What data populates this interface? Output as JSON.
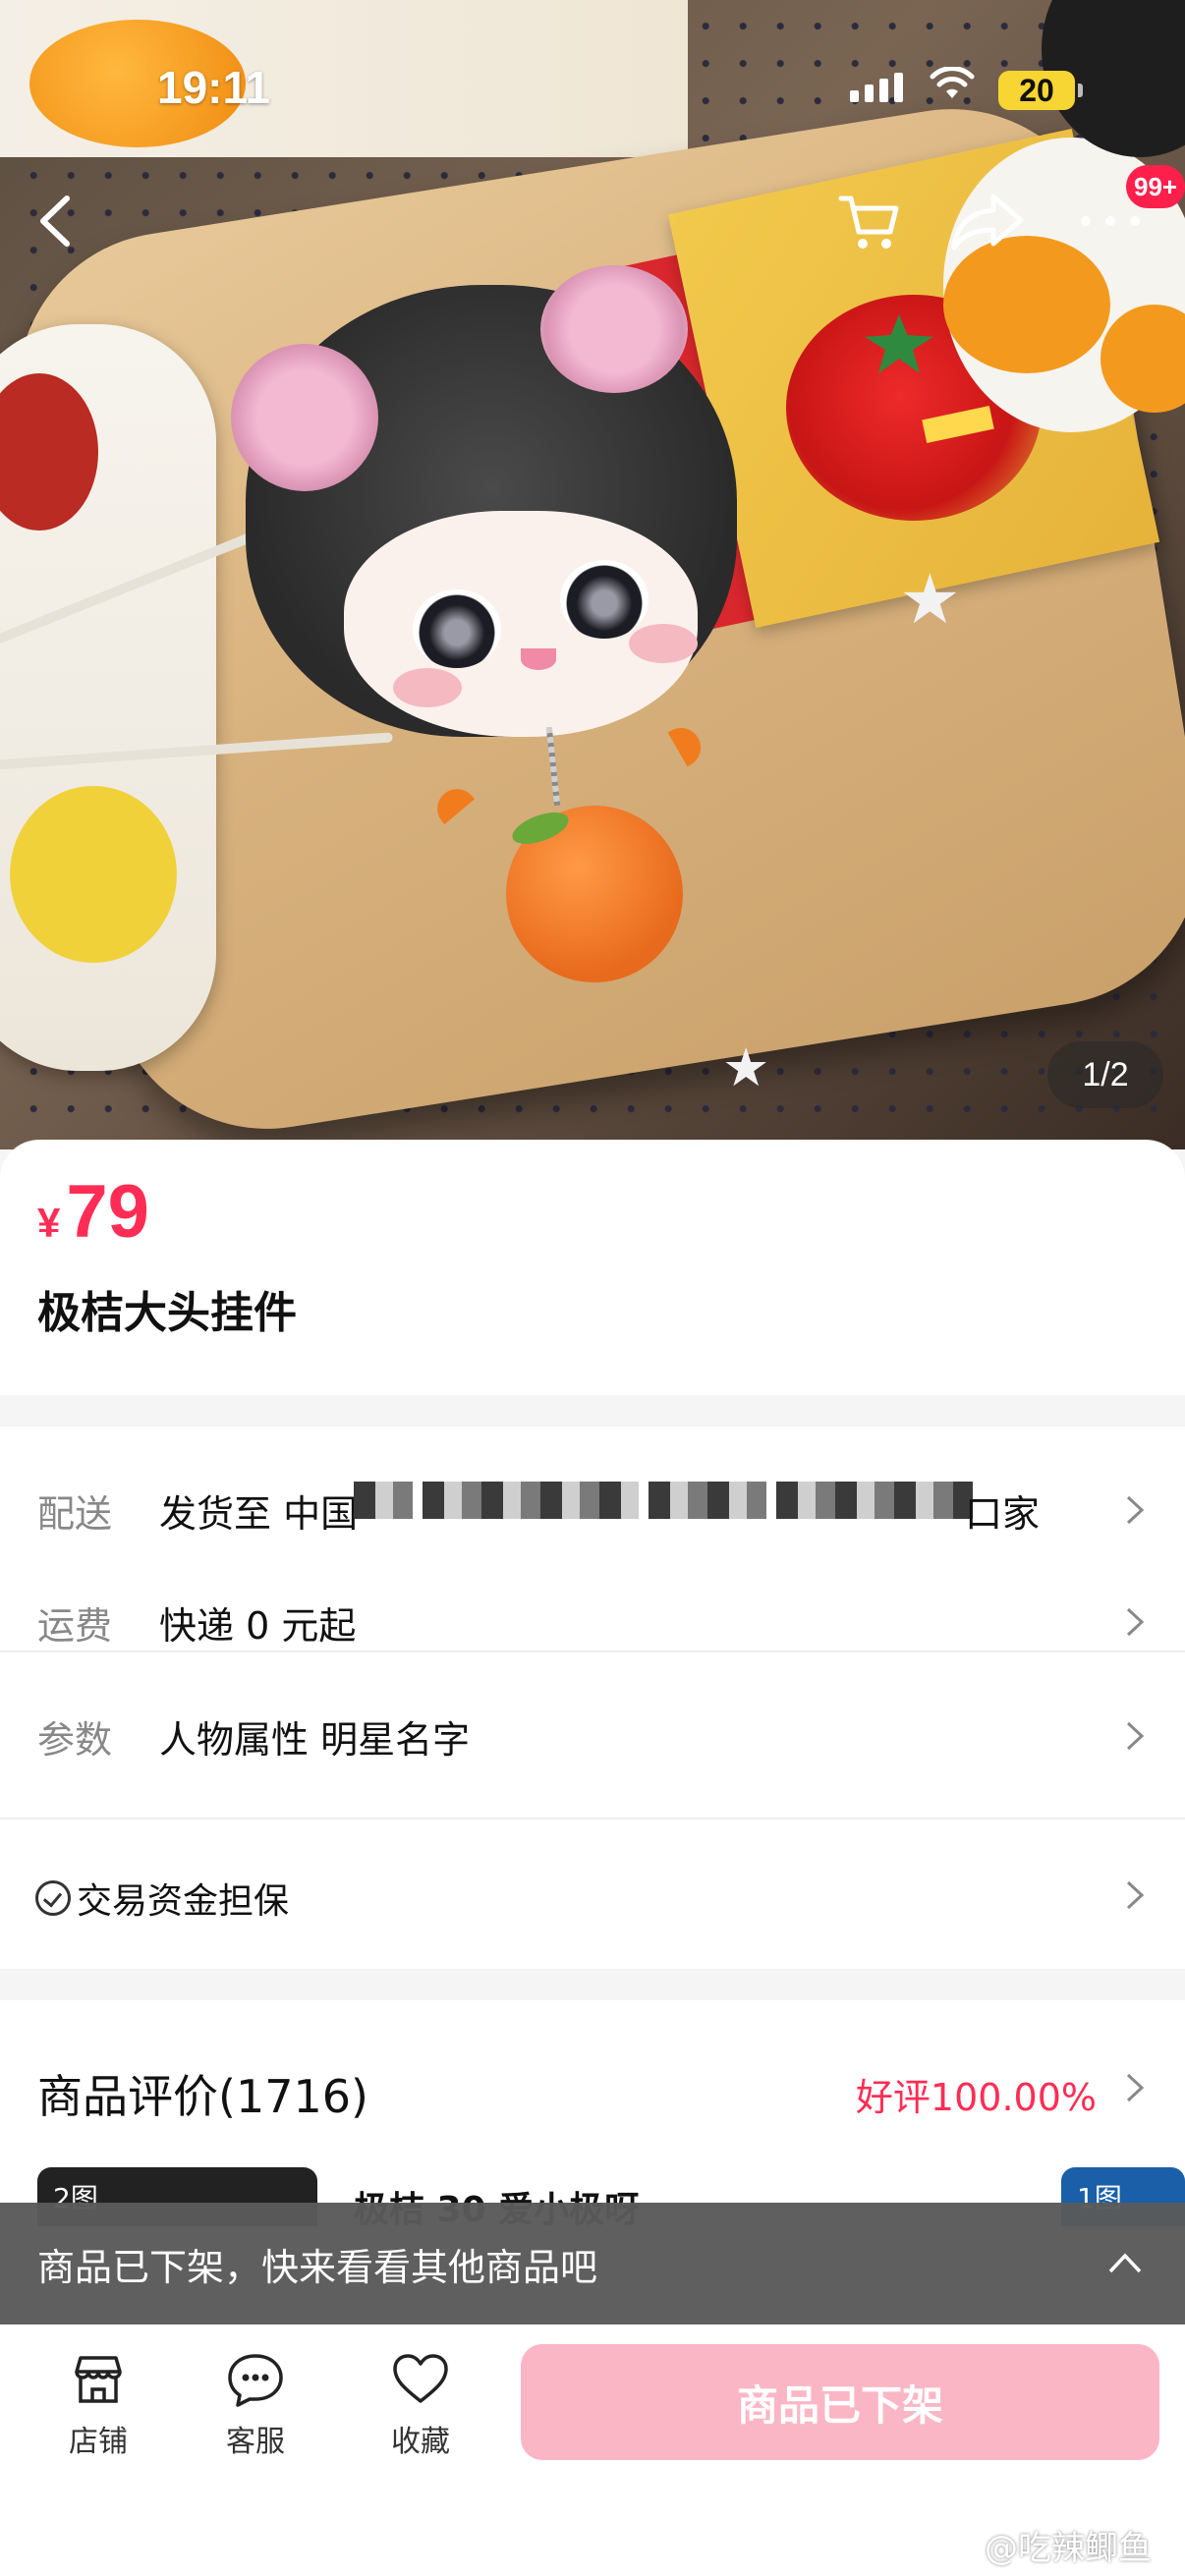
{
  "status_bar": {
    "time": "19:11",
    "battery": "20"
  },
  "top_nav": {
    "badge_count": "99+"
  },
  "gallery": {
    "counter": "1/2"
  },
  "product": {
    "price_symbol": "¥",
    "price": "79",
    "title": "极桔大头挂件"
  },
  "info": {
    "delivery_label": "配送",
    "delivery_value": "发货至 中国",
    "delivery_suffix": "口家",
    "shipping_label": "运费",
    "shipping_value": "快递 0 元起",
    "params_label": "参数",
    "params_value": "人物属性 明星名字",
    "guarantee": "交易资金担保"
  },
  "reviews": {
    "title": "商品评价(1716)",
    "rate": "好评100.00%",
    "thumb1_label": "2图",
    "thumb2_label": "1图",
    "snippet": "极桔 30 爱小极呀"
  },
  "toast": {
    "text": "商品已下架，快来看看其他商品吧"
  },
  "bottom_bar": {
    "store_label": "店铺",
    "service_label": "客服",
    "favorite_label": "收藏",
    "buy_button": "商品已下架"
  },
  "watermark": "@吃辣鲫鱼",
  "colors": {
    "accent": "#ff2d55",
    "disabled_button": "#fbb6c5",
    "toast_bg": "#5a5a5a",
    "badge": "#ff1f4b"
  }
}
